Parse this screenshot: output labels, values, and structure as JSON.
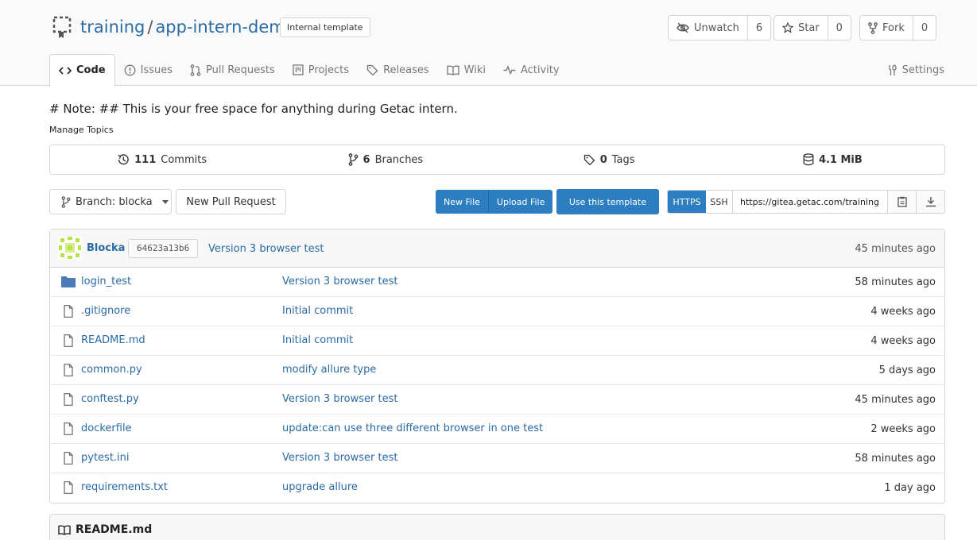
{
  "repo": {
    "owner": "training",
    "separator": "/",
    "name": "app-intern-demo",
    "badge": "Internal template"
  },
  "actions": {
    "watch_label": "Unwatch",
    "watch_count": "6",
    "star_label": "Star",
    "star_count": "0",
    "fork_label": "Fork",
    "fork_count": "0"
  },
  "nav": {
    "tabs": [
      {
        "label": "Code",
        "icon": "code-icon"
      },
      {
        "label": "Issues",
        "icon": "issue-icon"
      },
      {
        "label": "Pull Requests",
        "icon": "pull-request-icon"
      },
      {
        "label": "Projects",
        "icon": "project-icon"
      },
      {
        "label": "Releases",
        "icon": "tag-icon"
      },
      {
        "label": "Wiki",
        "icon": "book-icon"
      },
      {
        "label": "Activity",
        "icon": "pulse-icon"
      }
    ],
    "settings": "Settings"
  },
  "description": "# Note: ## This is your free space for anything during Getac intern.",
  "manage_topics": "Manage Topics",
  "stats": {
    "commits_count": "111",
    "commits_label": "Commits",
    "branches_count": "6",
    "branches_label": "Branches",
    "tags_count": "0",
    "tags_label": "Tags",
    "size": "4.1 MiB"
  },
  "toolbar": {
    "branch": "Branch: blocka",
    "new_pull_request": "New Pull Request",
    "new_file": "New File",
    "upload_file": "Upload File",
    "use_template": "Use this template",
    "https": "HTTPS",
    "ssh": "SSH",
    "clone_url": "https://gitea.getac.com/training"
  },
  "latest_commit": {
    "author": "Blocka",
    "sha": "64623a13b6",
    "message": "Version 3 browser test",
    "time": "45 minutes ago"
  },
  "files": [
    {
      "name": "login_test",
      "type": "folder",
      "message": "Version 3 browser test",
      "time": "58 minutes ago"
    },
    {
      "name": ".gitignore",
      "type": "file",
      "message": "Initial commit",
      "time": "4 weeks ago"
    },
    {
      "name": "README.md",
      "type": "file",
      "message": "Initial commit",
      "time": "4 weeks ago"
    },
    {
      "name": "common.py",
      "type": "file",
      "message": "modify allure type",
      "time": "5 days ago"
    },
    {
      "name": "conftest.py",
      "type": "file",
      "message": "Version 3 browser test",
      "time": "45 minutes ago"
    },
    {
      "name": "dockerfile",
      "type": "file",
      "message": "update:can use three different browser in one test",
      "time": "2 weeks ago"
    },
    {
      "name": "pytest.ini",
      "type": "file",
      "message": "Version 3 browser test",
      "time": "58 minutes ago"
    },
    {
      "name": "requirements.txt",
      "type": "file",
      "message": "upgrade allure",
      "time": "1 day ago"
    }
  ],
  "readme": {
    "title": "README.md"
  },
  "colors": {
    "link": "#2a6aa5",
    "primary": "#2c7ec0",
    "border": "#d4d4d5"
  }
}
